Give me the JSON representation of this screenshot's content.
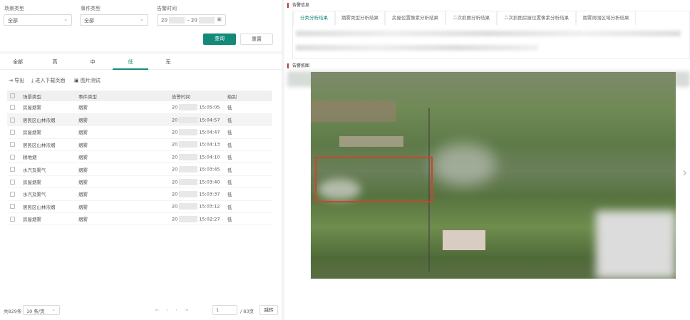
{
  "filters": {
    "scene_label": "场景类型",
    "scene_value": "全部",
    "event_label": "事件类型",
    "event_value": "全部",
    "time_label": "告警时间",
    "time_start": "20",
    "time_sep": "-",
    "time_end": "20",
    "query": "查询",
    "reset": "重置"
  },
  "level_tabs": [
    "全部",
    "高",
    "中",
    "低",
    "无"
  ],
  "active_tab": 3,
  "toolbar": {
    "export": "导出",
    "download": "进入下载页面",
    "test": "图片测试"
  },
  "table": {
    "headers": [
      "场景类型",
      "事件类型",
      "告警时间",
      "级别"
    ],
    "rows": [
      {
        "scene": "房屋烟雾",
        "event": "烟雾",
        "date": "20",
        "time": "15:05:05",
        "level": "低"
      },
      {
        "scene": "居民区山林浓烟",
        "event": "烟雾",
        "date": "20",
        "time": "15:04:57",
        "level": "低"
      },
      {
        "scene": "房屋烟雾",
        "event": "烟雾",
        "date": "20",
        "time": "15:04:47",
        "level": "低"
      },
      {
        "scene": "居民区山林浓烟",
        "event": "烟雾",
        "date": "20",
        "time": "15:04:13",
        "level": "低"
      },
      {
        "scene": "耕地烟",
        "event": "烟雾",
        "date": "20",
        "time": "15:04:10",
        "level": "低"
      },
      {
        "scene": "水汽及雾气",
        "event": "烟雾",
        "date": "20",
        "time": "15:03:45",
        "level": "低"
      },
      {
        "scene": "房屋烟雾",
        "event": "烟雾",
        "date": "20",
        "time": "15:03:40",
        "level": "低"
      },
      {
        "scene": "水汽及雾气",
        "event": "烟雾",
        "date": "20",
        "time": "15:03:37",
        "level": "低"
      },
      {
        "scene": "居民区山林浓烟",
        "event": "烟雾",
        "date": "20",
        "time": "15:03:12",
        "level": "低"
      },
      {
        "scene": "房屋烟雾",
        "event": "烟雾",
        "date": "20",
        "time": "15:02:27",
        "level": "低"
      }
    ]
  },
  "pagination": {
    "total": "共829条",
    "page_size": "10 条/页",
    "page": "1",
    "pages": "/ 83页",
    "jump": "跳转"
  },
  "right": {
    "info_title": "告警信息",
    "tabs": [
      "分类分析结果",
      "烟雾类型分析结果",
      "房屋位置像素分析结果",
      "二次抓图分析结果",
      "二次抓图房屋位置像素分析结果",
      "烟雾周围区域分析结果"
    ],
    "image_title": "告警抓图"
  },
  "colors": {
    "accent": "#14897a",
    "detection_box": "#d0432c"
  }
}
